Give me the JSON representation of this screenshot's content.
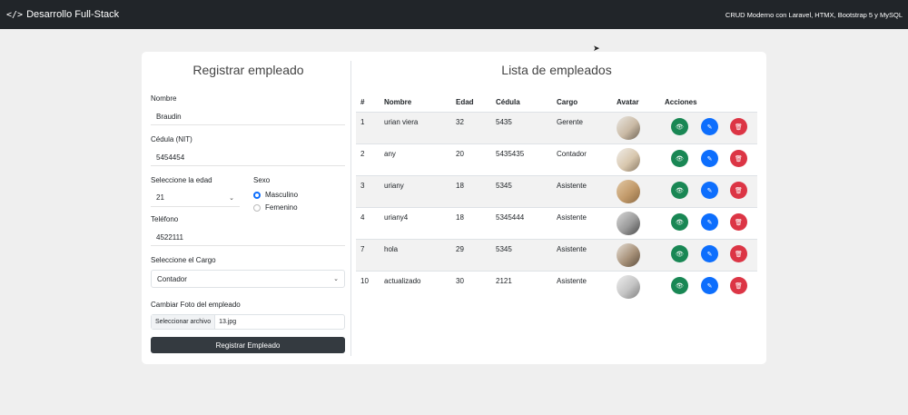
{
  "navbar": {
    "icon": "code-icon",
    "brand": "Desarrollo Full-Stack",
    "right_text": "CRUD Moderno con Laravel, HTMX, Bootstrap 5 y MySQL"
  },
  "form": {
    "title": "Registrar empleado",
    "nombre_label": "Nombre",
    "nombre_value": "Braudin",
    "cedula_label": "Cédula (NIT)",
    "cedula_value": "5454454",
    "edad_label": "Seleccione la edad",
    "edad_value": "21",
    "sexo_label": "Sexo",
    "sexo_options": [
      "Masculino",
      "Femenino"
    ],
    "sexo_selected": "Masculino",
    "telefono_label": "Teléfono",
    "telefono_value": "4522111",
    "cargo_label": "Seleccione el Cargo",
    "cargo_value": "Contador",
    "foto_label": "Cambiar Foto del empleado",
    "foto_button": "Seleccionar archivo",
    "foto_filename": "13.jpg",
    "submit_label": "Registrar Empleado"
  },
  "list": {
    "title": "Lista de empleados",
    "headers": [
      "#",
      "Nombre",
      "Edad",
      "Cédula",
      "Cargo",
      "Avatar",
      "Acciones"
    ],
    "rows": [
      {
        "id": "1",
        "nombre": "urian viera",
        "edad": "32",
        "cedula": "5435",
        "cargo": "Gerente"
      },
      {
        "id": "2",
        "nombre": "any",
        "edad": "20",
        "cedula": "5435435",
        "cargo": "Contador"
      },
      {
        "id": "3",
        "nombre": "uriany",
        "edad": "18",
        "cedula": "5345",
        "cargo": "Asistente"
      },
      {
        "id": "4",
        "nombre": "uriany4",
        "edad": "18",
        "cedula": "5345444",
        "cargo": "Asistente"
      },
      {
        "id": "7",
        "nombre": "hola",
        "edad": "29",
        "cedula": "5345",
        "cargo": "Asistente"
      },
      {
        "id": "10",
        "nombre": "actualizado",
        "edad": "30",
        "cedula": "2121",
        "cargo": "Asistente"
      }
    ],
    "action_icons": [
      "view-icon",
      "edit-icon",
      "delete-icon"
    ],
    "colors": {
      "view": "#198754",
      "edit": "#0d6efd",
      "delete": "#dc3545"
    }
  }
}
